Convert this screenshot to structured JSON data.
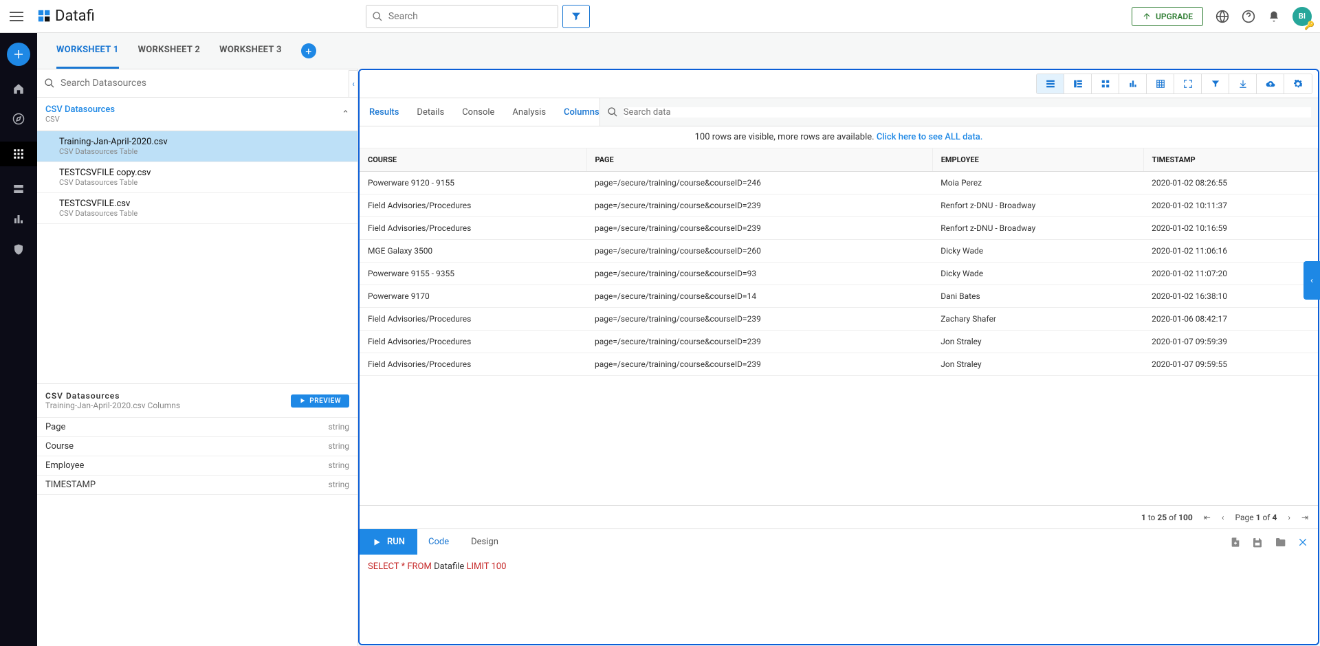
{
  "topbar": {
    "brand": "Datafi",
    "search_placeholder": "Search",
    "upgrade": "UPGRADE",
    "avatar_initials": "BI"
  },
  "worksheets": {
    "tabs": [
      "WORKSHEET 1",
      "WORKSHEET 2",
      "WORKSHEET 3"
    ],
    "active_index": 0
  },
  "datasources": {
    "search_placeholder": "Search Datasources",
    "group_title": "CSV Datasources",
    "group_sub": "CSV",
    "files": [
      {
        "name": "Training-Jan-April-2020.csv",
        "sub": "CSV Datasources Table",
        "selected": true
      },
      {
        "name": "TESTCSVFILE copy.csv",
        "sub": "CSV Datasources Table",
        "selected": false
      },
      {
        "name": "TESTCSVFILE.csv",
        "sub": "CSV Datasources Table",
        "selected": false
      }
    ],
    "preview_title": "CSV Datasources",
    "preview_sub": "Training-Jan-April-2020.csv Columns",
    "preview_btn": "PREVIEW",
    "columns": [
      {
        "name": "Page",
        "type": "string"
      },
      {
        "name": "Course",
        "type": "string"
      },
      {
        "name": "Employee",
        "type": "string"
      },
      {
        "name": "TIMESTAMP",
        "type": "string"
      }
    ]
  },
  "results": {
    "subtabs": [
      "Results",
      "Details",
      "Console",
      "Analysis",
      "Columns"
    ],
    "subtab_active": [
      true,
      false,
      false,
      false,
      true
    ],
    "search_placeholder": "Search data",
    "banner_text": "100 rows are visible, more rows are available. ",
    "banner_link": "Click here to see ALL data.",
    "headers": [
      "COURSE",
      "PAGE",
      "EMPLOYEE",
      "TIMESTAMP"
    ],
    "rows": [
      [
        "Powerware 9120 - 9155",
        "page=/secure/training/course&courseID=246",
        "Moia Perez",
        "2020-01-02 08:26:55"
      ],
      [
        "Field Advisories/Procedures",
        "page=/secure/training/course&courseID=239",
        "Renfort z-DNU - Broadway",
        "2020-01-02 10:11:37"
      ],
      [
        "Field Advisories/Procedures",
        "page=/secure/training/course&courseID=239",
        "Renfort z-DNU - Broadway",
        "2020-01-02 10:16:59"
      ],
      [
        "MGE Galaxy 3500",
        "page=/secure/training/course&courseID=260",
        "Dicky Wade",
        "2020-01-02 11:06:16"
      ],
      [
        "Powerware 9155 - 9355",
        "page=/secure/training/course&courseID=93",
        "Dicky Wade",
        "2020-01-02 11:07:20"
      ],
      [
        "Powerware 9170",
        "page=/secure/training/course&courseID=14",
        "Dani Bates",
        "2020-01-02 16:38:10"
      ],
      [
        "Field Advisories/Procedures",
        "page=/secure/training/course&courseID=239",
        "Zachary Shafer",
        "2020-01-06 08:42:17"
      ],
      [
        "Field Advisories/Procedures",
        "page=/secure/training/course&courseID=239",
        "Jon Straley",
        "2020-01-07 09:59:39"
      ],
      [
        "Field Advisories/Procedures",
        "page=/secure/training/course&courseID=239",
        "Jon Straley",
        "2020-01-07 09:59:55"
      ]
    ],
    "pager_rows_a": "1",
    "pager_rows_b": " to ",
    "pager_rows_c": "25",
    "pager_rows_d": " of ",
    "pager_rows_e": "100",
    "pager_page_a": "Page ",
    "pager_page_b": "1",
    "pager_page_c": " of ",
    "pager_page_d": "4"
  },
  "runbar": {
    "run": "RUN",
    "tabs": [
      "Code",
      "Design"
    ],
    "active_index": 0
  },
  "sql": {
    "kw1": "SELECT ",
    "star": "* ",
    "kw2": "FROM ",
    "ident": "Datafile ",
    "kw3": "LIMIT 100"
  }
}
